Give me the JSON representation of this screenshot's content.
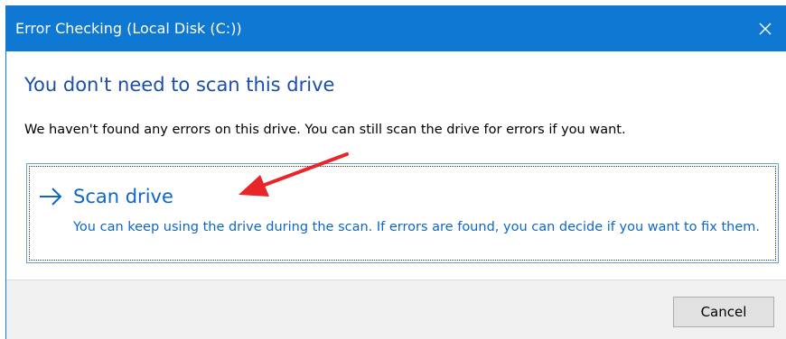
{
  "window": {
    "title": "Error Checking (Local Disk (C:))",
    "close_icon": "close-icon"
  },
  "content": {
    "heading": "You don't need to scan this drive",
    "description": "We haven't found any errors on this drive. You can still scan the drive for errors if you want."
  },
  "option": {
    "arrow_icon": "arrow-right-icon",
    "title": "Scan drive",
    "description": "You can keep using the drive during the scan. If errors are found, you can decide if you want to fix them."
  },
  "footer": {
    "cancel_label": "Cancel"
  },
  "colors": {
    "titlebar": "#0f78d2",
    "heading": "#1a4ea8",
    "link": "#0f66c6",
    "annotation_arrow": "#e8262a"
  }
}
